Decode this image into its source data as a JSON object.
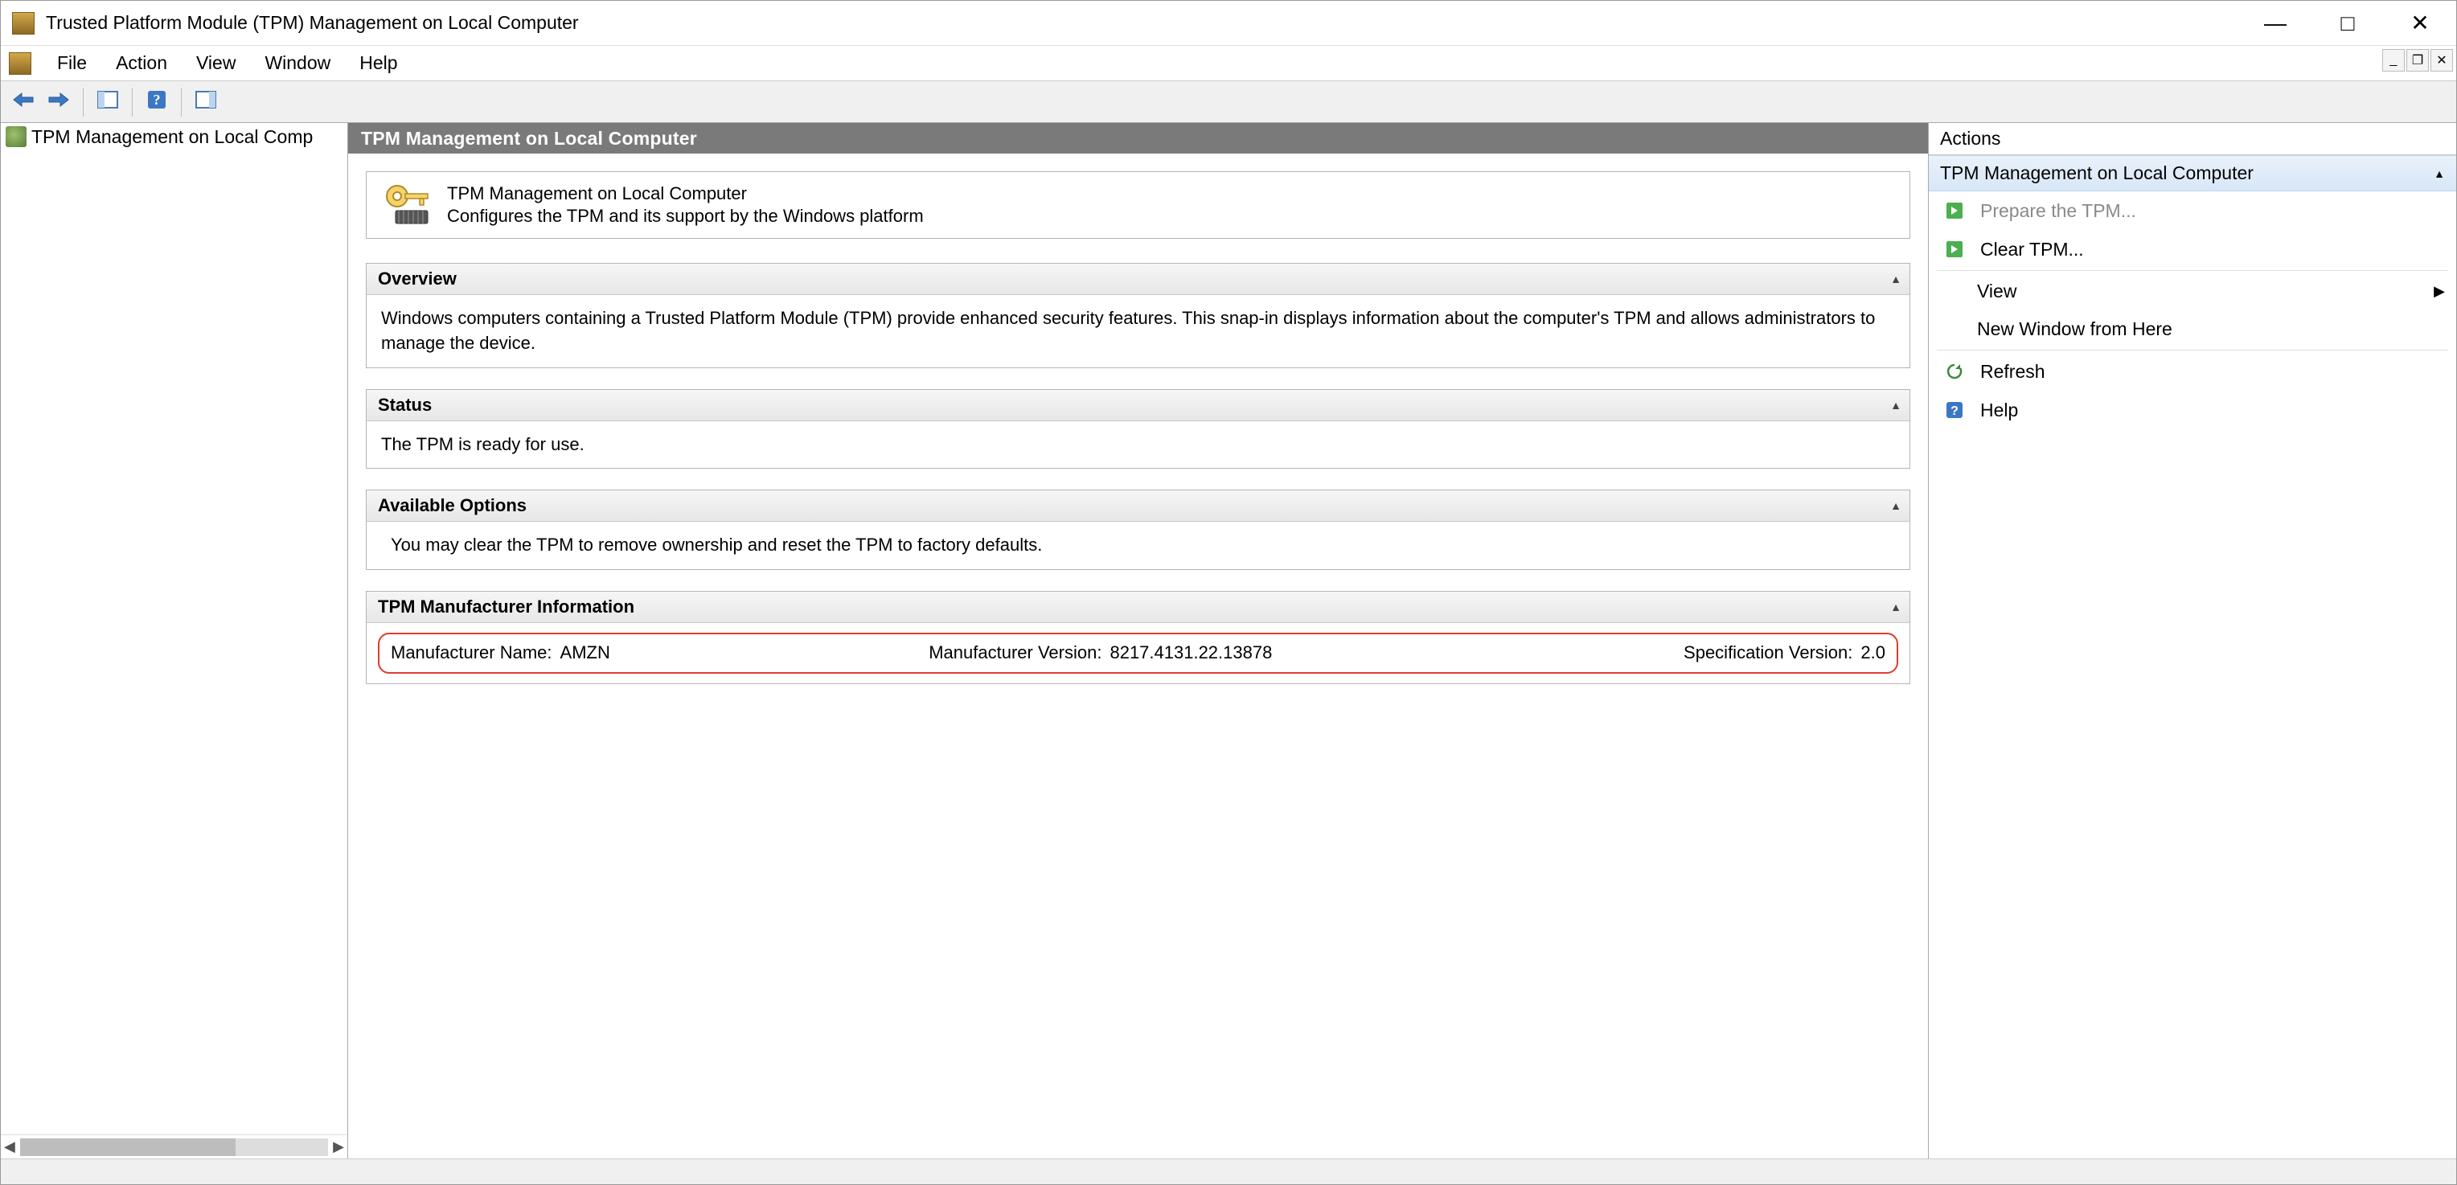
{
  "window": {
    "title": "Trusted Platform Module (TPM) Management on Local Computer"
  },
  "menu": {
    "file": "File",
    "action": "Action",
    "view": "View",
    "window": "Window",
    "help": "Help"
  },
  "tree": {
    "node0": "TPM Management on Local Comp"
  },
  "center": {
    "header": "TPM Management on Local Computer",
    "intro_title": "TPM Management on Local Computer",
    "intro_desc": "Configures the TPM and its support by the Windows platform",
    "sections": {
      "overview": {
        "title": "Overview",
        "body": "Windows computers containing a Trusted Platform Module (TPM) provide enhanced security features. This snap-in displays information about the computer's TPM and allows administrators to manage the device."
      },
      "status": {
        "title": "Status",
        "body": "The TPM is ready for use."
      },
      "options": {
        "title": "Available Options",
        "body": "You may clear the TPM to remove ownership and reset the TPM to factory defaults."
      },
      "mfr": {
        "title": "TPM Manufacturer Information",
        "name_label": "Manufacturer Name:",
        "name_value": "AMZN",
        "ver_label": "Manufacturer Version:",
        "ver_value": "8217.4131.22.13878",
        "spec_label": "Specification Version:",
        "spec_value": "2.0"
      }
    }
  },
  "actions": {
    "header": "Actions",
    "group": "TPM Management on Local Computer",
    "prepare": "Prepare the TPM...",
    "clear": "Clear TPM...",
    "view": "View",
    "newwin": "New Window from Here",
    "refresh": "Refresh",
    "help": "Help"
  }
}
